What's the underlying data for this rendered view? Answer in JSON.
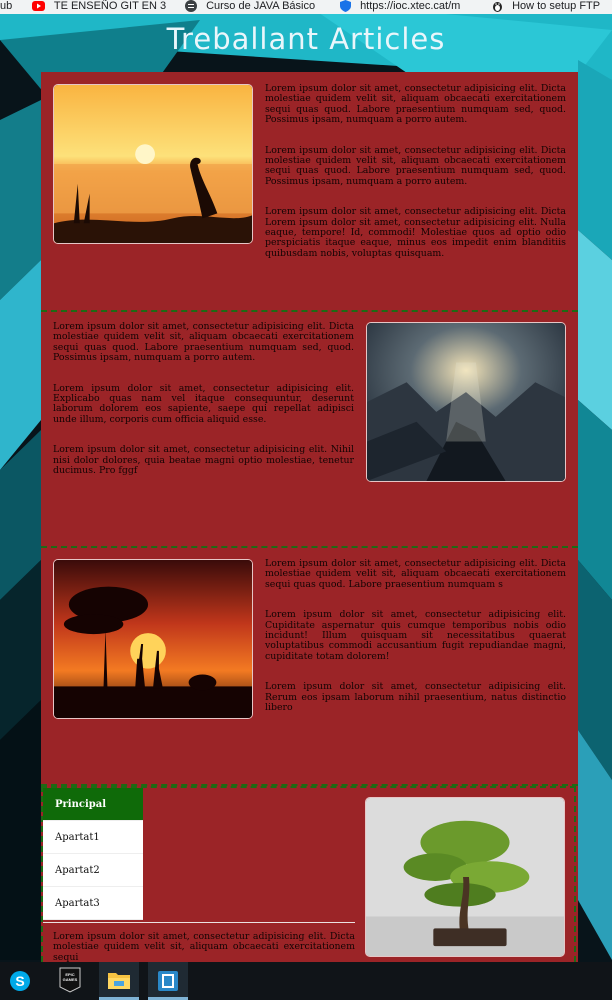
{
  "bookmarks": [
    {
      "label": "ub",
      "icon": "page-icon"
    },
    {
      "label": "TE ENSEÑO GIT EN 3",
      "icon": "youtube-icon"
    },
    {
      "label": "Curso de JAVA Básico",
      "icon": "course-icon"
    },
    {
      "label": "https://ioc.xtec.cat/m",
      "icon": "shield-icon"
    },
    {
      "label": "How to setup FTP",
      "icon": "linux-icon"
    }
  ],
  "site_title": "Treballant Articles",
  "articles": [
    {
      "image": "heron-sunset-painting",
      "paragraphs": [
        "Lorem ipsum dolor sit amet, consectetur adipisicing elit. Dicta molestiae quidem velit sit, aliquam obcaecati exercitationem sequi quas quod. Labore praesentium numquam sed, quod. Possimus ipsam, numquam a porro autem.",
        "Lorem ipsum dolor sit amet, consectetur adipisicing elit. Dicta molestiae quidem velit sit, aliquam obcaecati exercitationem sequi quas quod. Labore praesentium numquam sed, quod. Possimus ipsam, numquam a porro autem.",
        "Lorem ipsum dolor sit amet, consectetur adipisicing elit. Dicta Lorem ipsum dolor sit amet, consectetur adipisicing elit. Nulla eaque, tempore! Id, commodi! Molestiae quos ad optio odio perspiciatis itaque eaque, minus eos impedit enim blanditiis quibusdam nobis, voluptas quisquam."
      ]
    },
    {
      "image": "mountain-valley-photo",
      "paragraphs": [
        "Lorem ipsum dolor sit amet, consectetur adipisicing elit. Dicta molestiae quidem velit sit, aliquam obcaecati exercitationem sequi quas quod. Labore praesentium numquam sed, quod. Possimus ipsam, numquam a porro autem.",
        "Lorem ipsum dolor sit amet, consectetur adipisicing elit. Explicabo quas nam vel itaque consequuntur, deserunt laborum dolorem eos sapiente, saepe qui repellat adipisci unde illum, corporis cum officia aliquid esse.",
        "Lorem ipsum dolor sit amet, consectetur adipisicing elit. Nihil nisi dolor dolores, quia beatae magni optio molestiae, tenetur ducimus. Pro fggf"
      ]
    },
    {
      "image": "savanna-sunset-photo",
      "paragraphs": [
        "Lorem ipsum dolor sit amet, consectetur adipisicing elit. Dicta molestiae quidem velit sit, aliquam obcaecati exercitationem sequi quas quod. Labore praesentium numquam s",
        "Lorem ipsum dolor sit amet, consectetur adipisicing elit. Cupiditate aspernatur quis cumque temporibus nobis odio incidunt! Illum quisquam sit necessitatibus quaerat voluptatibus commodi accusantium fugit repudiandae magni, cupiditate totam dolorem!",
        "Lorem ipsum dolor sit amet, consectetur adipisicing elit. Rerum eos ipsam laborum nihil praesentium, natus distinctio libero"
      ]
    },
    {
      "image": "bonsai-photo",
      "paragraphs": [
        "Lorem ipsum dolor sit amet, consectetur adipisicing elit. Dicta molestiae quidem velit sit, aliquam obcaecati exercitationem sequi"
      ]
    }
  ],
  "menu": {
    "items": [
      {
        "label": "Principal",
        "active": true
      },
      {
        "label": "Apartat1",
        "active": false
      },
      {
        "label": "Apartat2",
        "active": false
      },
      {
        "label": "Apartat3",
        "active": false
      }
    ]
  },
  "taskbar": {
    "apps": [
      {
        "name": "skype-icon"
      },
      {
        "name": "epic-games-icon",
        "label": "EPIC GAMES"
      },
      {
        "name": "file-explorer-icon"
      },
      {
        "name": "app-window-icon"
      }
    ]
  },
  "colors": {
    "panel": "#9b2427",
    "separator": "#1e6a14",
    "menu_active": "#0f6a09",
    "title": "#e9f6fb"
  }
}
